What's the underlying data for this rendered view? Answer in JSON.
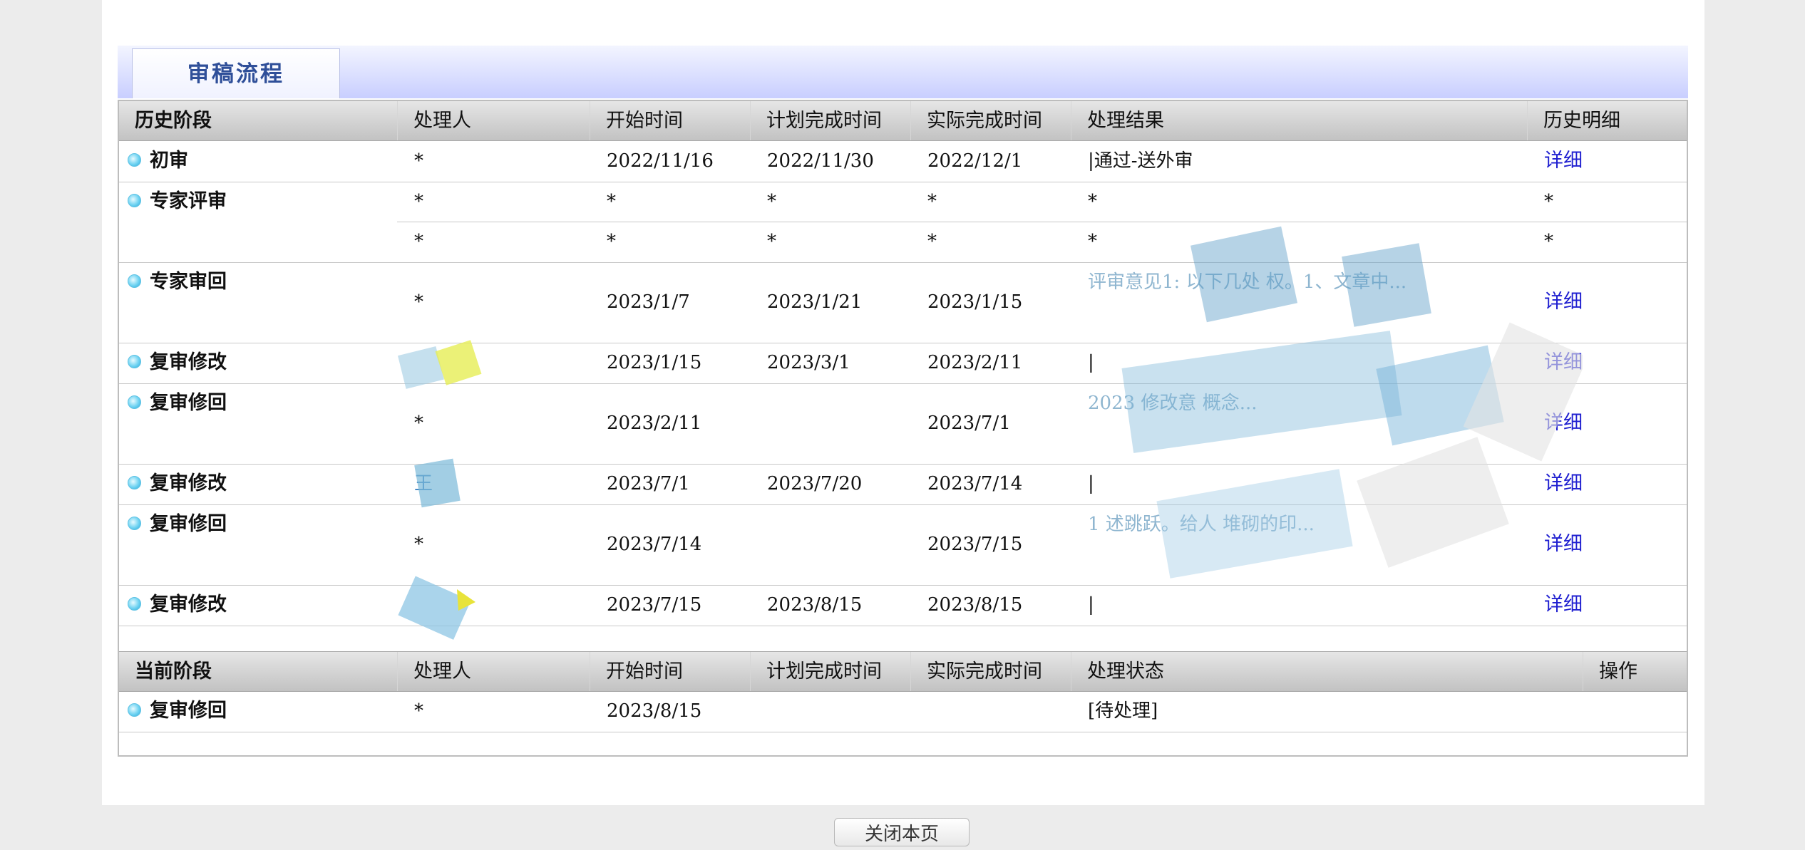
{
  "tab": {
    "title": "审稿流程"
  },
  "history_header": {
    "stage": "历史阶段",
    "handler": "处理人",
    "start": "开始时间",
    "planned": "计划完成时间",
    "actual": "实际完成时间",
    "result": "处理结果",
    "detail": "历史明细"
  },
  "history": [
    {
      "stage": "初审",
      "handler": "*",
      "start": "2022/11/16",
      "planned": "2022/11/30",
      "actual": "2022/12/1",
      "result": "|通过-送外审",
      "detail": "详细"
    },
    {
      "stage": "专家评审",
      "handler": "*",
      "start": "*",
      "planned": "*",
      "actual": "*",
      "result": "*",
      "detail": "*"
    },
    {
      "stage": "",
      "handler": "*",
      "start": "*",
      "planned": "*",
      "actual": "*",
      "result": "*",
      "detail": "*"
    },
    {
      "stage": "专家审回",
      "handler": "*",
      "start": "2023/1/7",
      "planned": "2023/1/21",
      "actual": "2023/1/15",
      "result": "评审意见1:  以下几处  权。1、文章中...",
      "detail": "详细"
    },
    {
      "stage": "复审修改",
      "handler": "",
      "start": "2023/1/15",
      "planned": "2023/3/1",
      "actual": "2023/2/11",
      "result": "|",
      "detail": "详细"
    },
    {
      "stage": "复审修回",
      "handler": "*",
      "start": "2023/2/11",
      "planned": "",
      "actual": "2023/7/1",
      "result": "2023  修改意  概念...",
      "detail": "详细"
    },
    {
      "stage": "复审修改",
      "handler": "王",
      "start": "2023/7/1",
      "planned": "2023/7/20",
      "actual": "2023/7/14",
      "result": "|",
      "detail": "详细"
    },
    {
      "stage": "复审修回",
      "handler": "*",
      "start": "2023/7/14",
      "planned": "",
      "actual": "2023/7/15",
      "result": "1  述跳跃。给人  堆砌的印...",
      "detail": "详细"
    },
    {
      "stage": "复审修改",
      "handler": "",
      "start": "2023/7/15",
      "planned": "2023/8/15",
      "actual": "2023/8/15",
      "result": "|",
      "detail": "详细"
    }
  ],
  "current_header": {
    "stage": "当前阶段",
    "handler": "处理人",
    "start": "开始时间",
    "planned": "计划完成时间",
    "actual": "实际完成时间",
    "status": "处理状态",
    "action": "操作"
  },
  "current": [
    {
      "stage": "复审修回",
      "handler": "*",
      "start": "2023/8/15",
      "planned": "",
      "actual": "",
      "status": "[待处理]",
      "action": ""
    }
  ],
  "footer": {
    "close_label": "关闭本页"
  }
}
